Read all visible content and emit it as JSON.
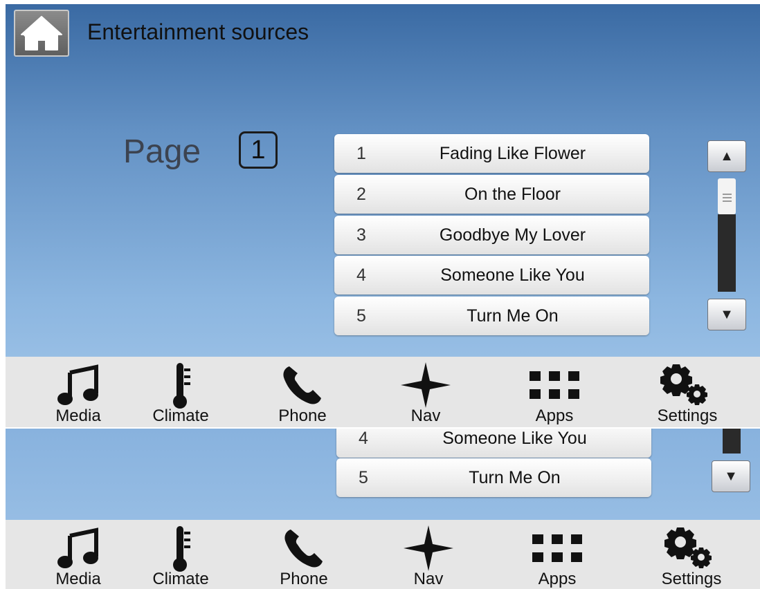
{
  "header": {
    "title": "Entertainment sources"
  },
  "pager": {
    "label": "Page",
    "number": "1"
  },
  "songs": [
    {
      "num": "1",
      "title": "Fading Like Flower"
    },
    {
      "num": "2",
      "title": "On the Floor"
    },
    {
      "num": "3",
      "title": "Goodbye My Lover"
    },
    {
      "num": "4",
      "title": "Someone Like You"
    },
    {
      "num": "5",
      "title": "Turn Me On"
    }
  ],
  "nav": [
    {
      "label": "Media",
      "icon": "music-note-icon"
    },
    {
      "label": "Climate",
      "icon": "thermometer-icon"
    },
    {
      "label": "Phone",
      "icon": "phone-icon"
    },
    {
      "label": "Nav",
      "icon": "compass-star-icon"
    },
    {
      "label": "Apps",
      "icon": "apps-grid-icon"
    },
    {
      "label": "Settings",
      "icon": "gears-icon"
    }
  ],
  "scroll": {
    "up": "▲",
    "down": "▼"
  },
  "colors": {
    "bg_top": "#3a6aa3",
    "bg_bottom": "#a5c8ea",
    "navbar": "#e6e6e6",
    "home_button": "#6f6f6f"
  }
}
